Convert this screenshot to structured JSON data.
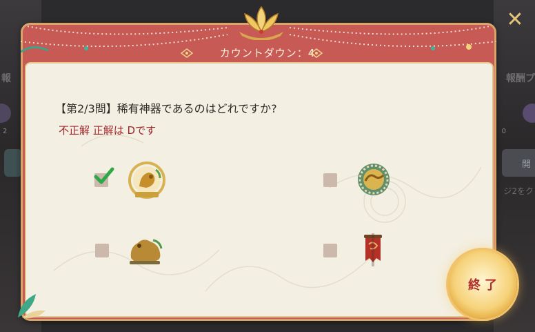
{
  "countdown": {
    "text": "カウントダウン：4"
  },
  "question": {
    "text": "【第2/3問】稀有神器であるのはどれですか?"
  },
  "result": {
    "text": "不正解 正解は Dです"
  },
  "options": [
    {
      "id": "A",
      "checked": true
    },
    {
      "id": "B",
      "checked": false
    },
    {
      "id": "C",
      "checked": false
    },
    {
      "id": "D",
      "checked": false
    }
  ],
  "end_button": {
    "label": "終了"
  },
  "close_button": {
    "label": "✕"
  },
  "background": {
    "left_label": "報",
    "right_label": "報酬プ",
    "right_label2": "ジ2をク",
    "right_button": "開",
    "left_num": "2",
    "right_num": "0"
  },
  "colors": {
    "frame": "#c85a55",
    "paper": "#f3efe2",
    "result_text": "#a0262b",
    "check": "#2fa84a",
    "gold": "#e3c478"
  }
}
